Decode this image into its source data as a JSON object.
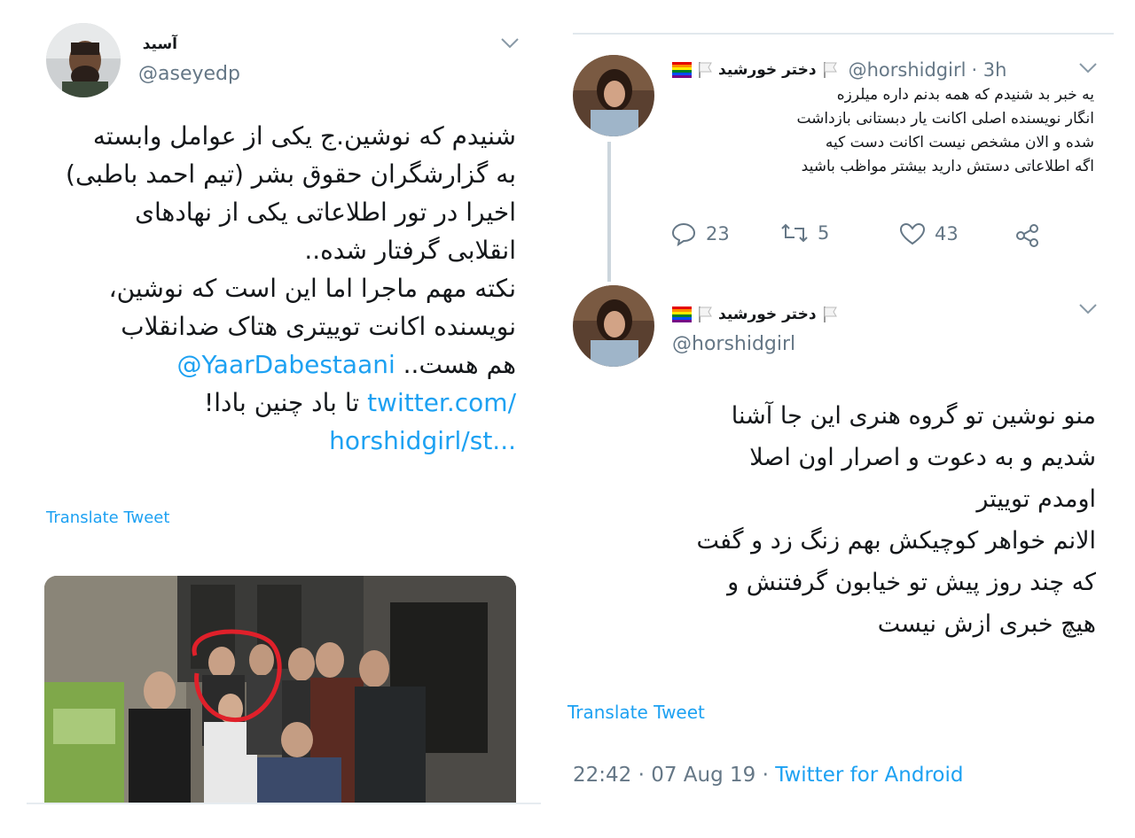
{
  "left_tweet": {
    "author_name": "آسید",
    "author_handle": "@aseyedp",
    "body_lines": [
      "شنیدم که نوشین.ج یکی از عوامل وابسته",
      "به گزارشگران حقوق بشر (تیم احمد باطبی)",
      "اخیرا در تور اطلاعاتی یکی از نهادهای",
      "انقلابی گرفتار شده..",
      "نکته مهم ماجرا اما این است که نوشین،",
      "نویسنده اکانت توییتری هتاک ضدانقلاب"
    ],
    "mention": "@YaarDabestaani",
    "mention_suffix": "هم هست..",
    "last_line": "تا باد چنین بادا!",
    "link_line1": "twitter.com/",
    "link_line2": "horshidgirl/st...",
    "translate_label": "Translate Tweet",
    "icons": {
      "menu": "chevron-down-icon"
    }
  },
  "right_reply": {
    "author_name": "دختر خورشید",
    "author_handle": "@horshidgirl",
    "time": "· 3h",
    "body_lines": [
      "یه خبر بد شنیدم که همه بدنم داره میلرزه",
      "انگار نویسنده اصلی اکانت یار دبستانی بازداشت",
      "شده و الان مشخص نیست اکانت دست کیه",
      "اگه اطلاعاتی دستش دارید بیشتر مواظب باشید"
    ],
    "replies": "23",
    "retweets": "5",
    "likes": "43"
  },
  "right_main": {
    "author_name": "دختر خورشید",
    "author_handle": "@horshidgirl",
    "body_lines": [
      "منو نوشین تو گروه هنری این جا آشنا",
      "شدیم و به دعوت و اصرار اون اصلا",
      "اومدم توییتر",
      "الانم خواهر کوچیکش بهم زنگ زد و گفت",
      "که چند روز پیش تو خیابون گرفتنش و",
      "هیچ خبری ازش نیست"
    ],
    "translate_label": "Translate Tweet",
    "timestamp": "22:42 · 07 Aug 19 ·",
    "client": "Twitter for Android"
  },
  "colors": {
    "link": "#1da1f2",
    "secondary": "#657786",
    "thread_line": "#ccd6dd",
    "highlight_circle": "#e0202a"
  }
}
